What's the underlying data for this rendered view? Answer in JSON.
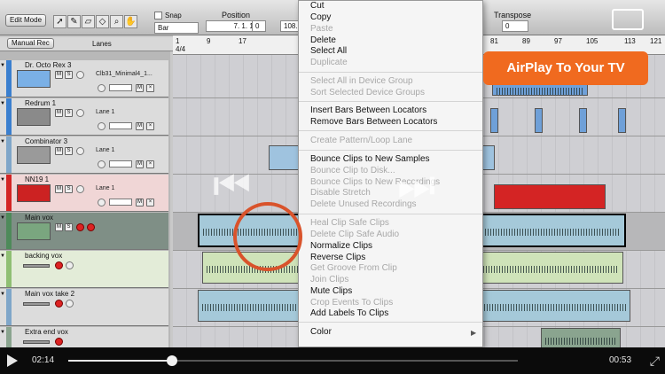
{
  "toolbar": {
    "mode_button": "Edit Mode",
    "snap_label": "Snap",
    "snap_value": "Bar",
    "position_label": "Position",
    "position_value": "7. 1. 1.",
    "position_ticks": "0",
    "tempo_value": "108.",
    "transpose_label": "Transpose",
    "transpose_value": "0"
  },
  "track_header": {
    "manual_rec": "Manual Rec",
    "lanes": "Lanes"
  },
  "ruler_ticks": [
    "1",
    "4/4",
    "9",
    "17",
    "81",
    "89",
    "97",
    "105",
    "113",
    "121"
  ],
  "tracks": [
    {
      "name": "Dr. Octo Rex 3",
      "lane": "Clb31_Minimal4_1...",
      "color": "#3a7fcf"
    },
    {
      "name": "Redrum 1",
      "lane": "Lane 1",
      "color": "#3a7fcf"
    },
    {
      "name": "Combinator 3",
      "lane": "Lane 1",
      "color": "#7fa6c9"
    },
    {
      "name": "NN19 1",
      "lane": "Lane 1",
      "color": "#d42424"
    },
    {
      "name": "Main vox",
      "lane": "",
      "color": "#4e8a5a"
    },
    {
      "name": "backing vox",
      "lane": "",
      "color": "#8fbf73"
    },
    {
      "name": "Main vox take 2",
      "lane": "",
      "color": "#7fa6c9"
    },
    {
      "name": "Extra end vox",
      "lane": "",
      "color": "#8aa48f"
    }
  ],
  "context_menu": {
    "items": [
      {
        "label": "Cut",
        "enabled": true
      },
      {
        "label": "Copy",
        "enabled": true
      },
      {
        "label": "Paste",
        "enabled": false
      },
      {
        "label": "Delete",
        "enabled": true
      },
      {
        "label": "Select All",
        "enabled": true
      },
      {
        "label": "Duplicate",
        "enabled": false
      },
      {
        "label": "Select All in Device Group",
        "enabled": false
      },
      {
        "label": "Sort Selected Device Groups",
        "enabled": false
      },
      {
        "label": "Insert Bars Between Locators",
        "enabled": true
      },
      {
        "label": "Remove Bars Between Locators",
        "enabled": true
      },
      {
        "label": "Create Pattern/Loop Lane",
        "enabled": false
      },
      {
        "label": "Bounce Clips to New Samples",
        "enabled": true
      },
      {
        "label": "Bounce Clip to Disk...",
        "enabled": false
      },
      {
        "label": "Bounce Clips to New Recordings",
        "enabled": false
      },
      {
        "label": "Disable Stretch",
        "enabled": false
      },
      {
        "label": "Delete Unused Recordings",
        "enabled": false
      },
      {
        "label": "Heal Clip Safe Clips",
        "enabled": false
      },
      {
        "label": "Delete Clip Safe Audio",
        "enabled": false
      },
      {
        "label": "Normalize Clips",
        "enabled": true
      },
      {
        "label": "Reverse Clips",
        "enabled": true
      },
      {
        "label": "Get Groove From Clip",
        "enabled": false
      },
      {
        "label": "Join Clips",
        "enabled": false
      },
      {
        "label": "Mute Clips",
        "enabled": true
      },
      {
        "label": "Crop Events To Clips",
        "enabled": false
      },
      {
        "label": "Add Labels To Clips",
        "enabled": true
      },
      {
        "label": "Color",
        "enabled": true
      }
    ],
    "color_arrow": "▶"
  },
  "overlay": {
    "airplay": "AirPlay To Your TV",
    "prev_icon": "⏮",
    "next_icon": "⏭"
  },
  "player": {
    "elapsed": "02:14",
    "remaining": "00:53",
    "progress": 0.23
  }
}
